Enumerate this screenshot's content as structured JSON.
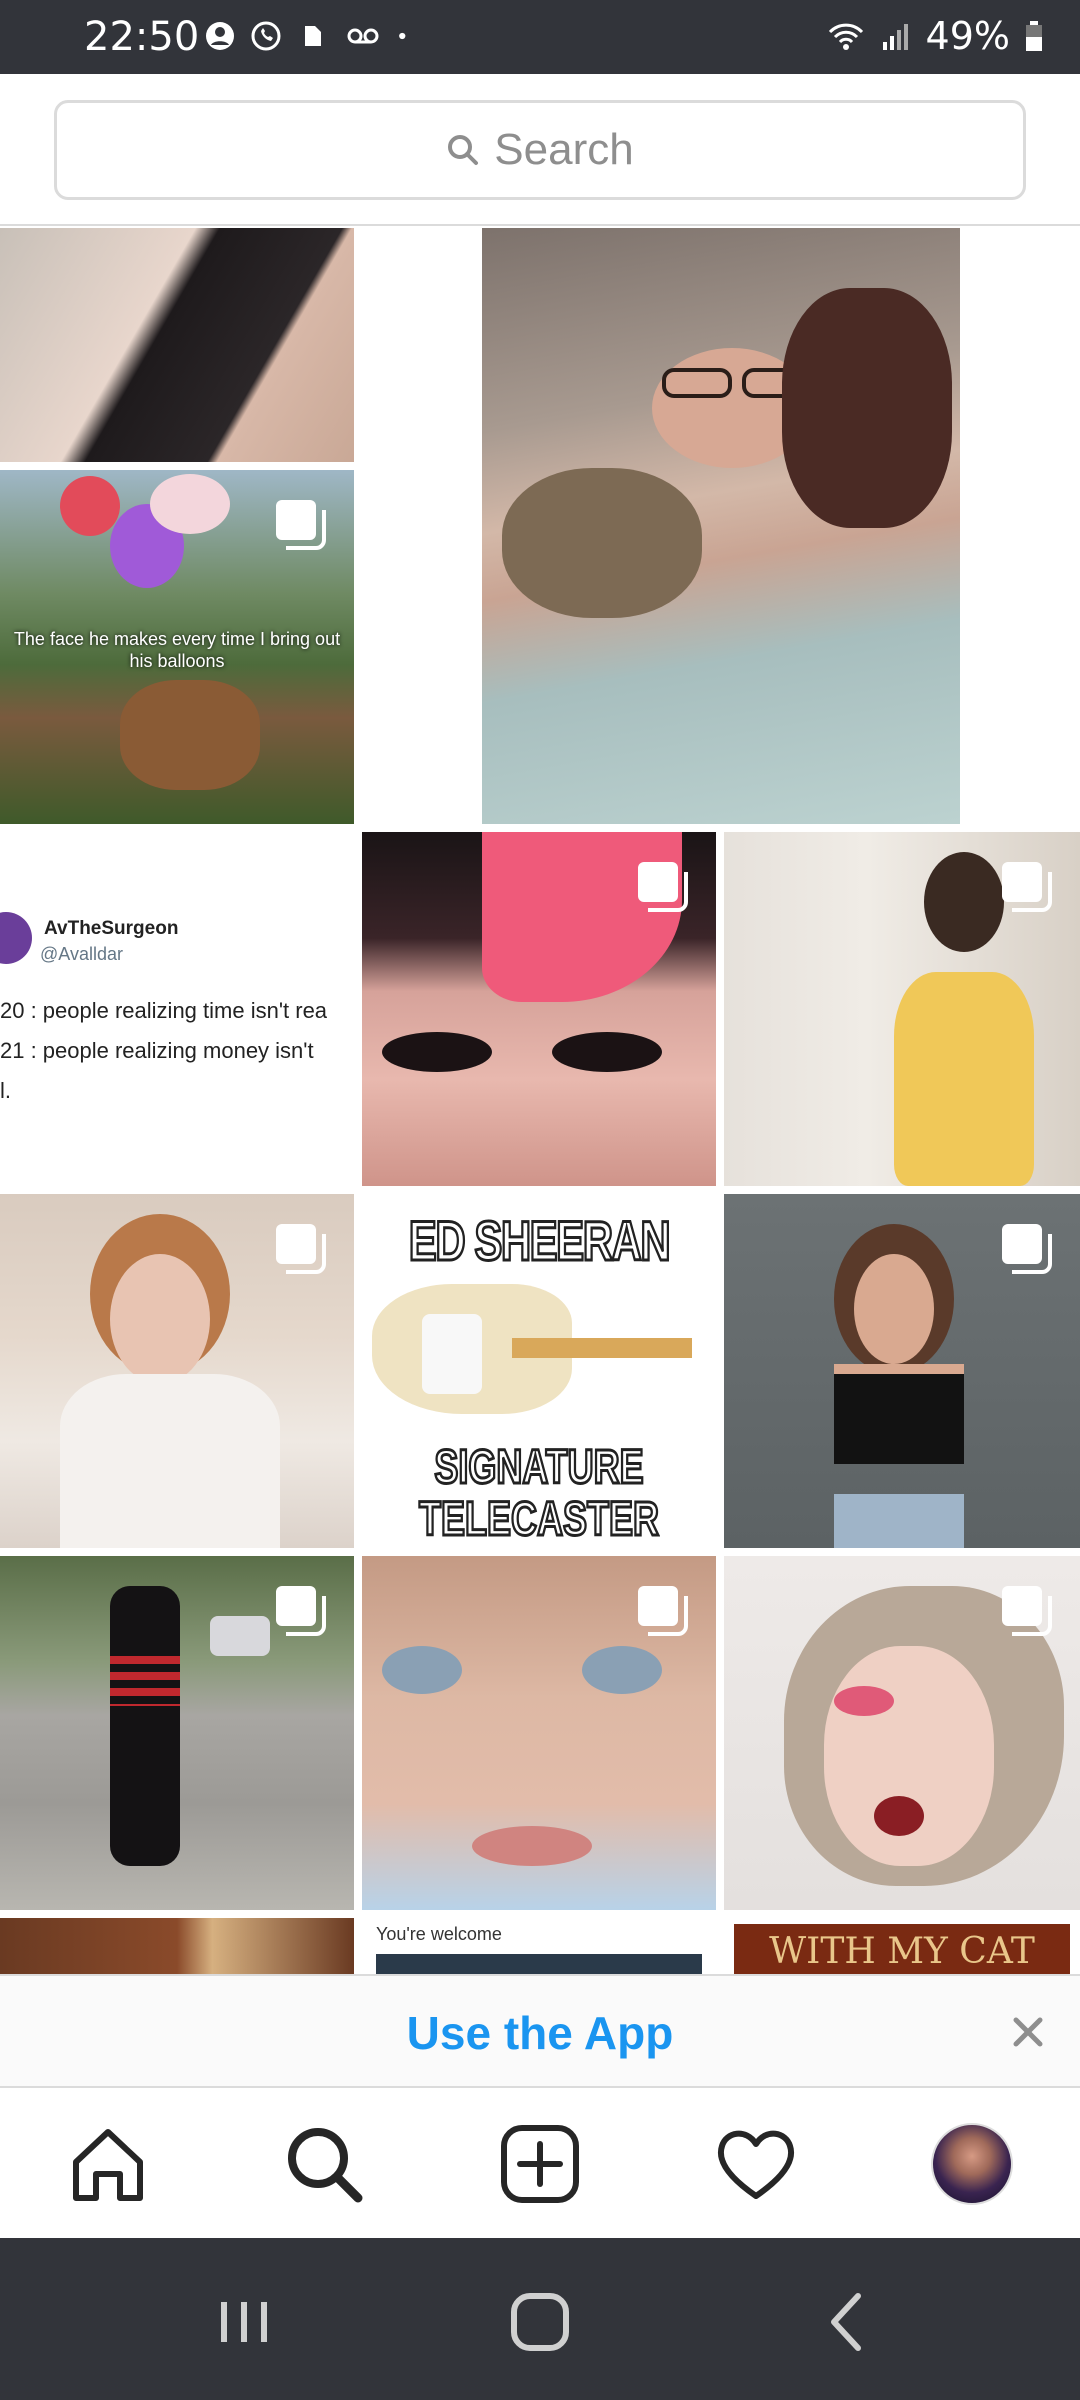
{
  "status_bar": {
    "time": "22:50",
    "battery": "49%",
    "left_icons": [
      "account-icon",
      "whatsapp-icon",
      "evernote-icon",
      "voicemail-icon",
      "dot-icon"
    ],
    "right_icons": [
      "wifi-icon",
      "signal-icon",
      "battery-icon"
    ]
  },
  "search": {
    "placeholder": "Search"
  },
  "grid": {
    "tile2_caption": "The face he makes every time I bring out his balloons",
    "tweet": {
      "name": "AvTheSurgeon",
      "handle": "@Avalldar",
      "line1": "20 : people realizing time isn't rea",
      "line2": "21 : people realizing money isn't",
      "line3": "l."
    },
    "meme": {
      "top": "ED SHEERAN",
      "bottom1": "SIGNATURE",
      "bottom2": "TELECASTER"
    },
    "welcome_text": "You're welcome",
    "cat_text": "WITH MY CAT"
  },
  "use_app": {
    "label": "Use the App"
  },
  "bottom_nav": {
    "items": [
      "home-icon",
      "search-icon",
      "new-post-icon",
      "activity-heart-icon",
      "profile-avatar"
    ]
  },
  "colors": {
    "accent": "#1a95f0",
    "status_bar": "#32343a"
  }
}
